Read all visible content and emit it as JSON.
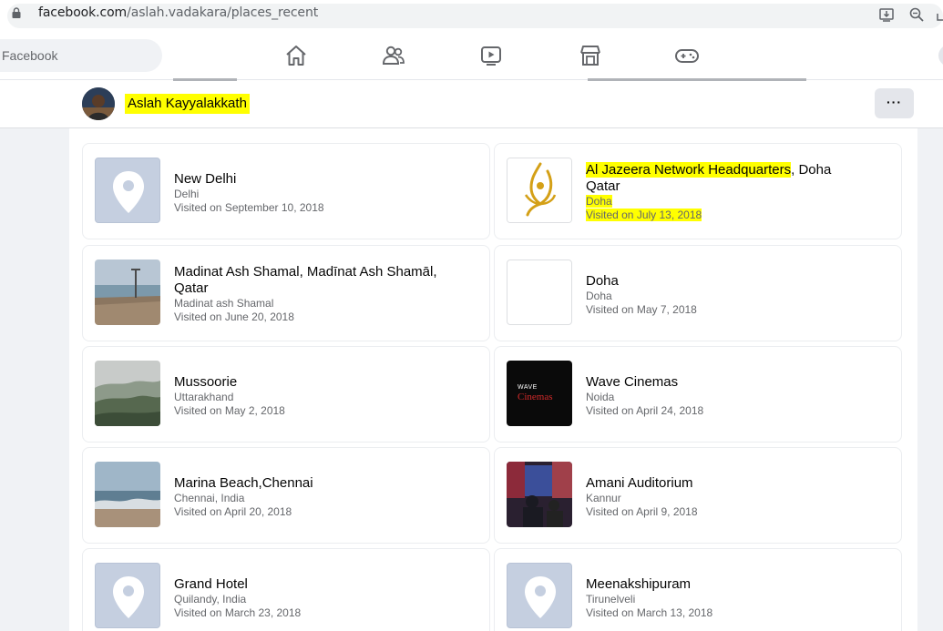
{
  "browser": {
    "url_host": "facebook.com",
    "url_path": "/aslah.vadakara/places_recent"
  },
  "fb_nav": {
    "search_placeholder": "Facebook"
  },
  "profile": {
    "name": "Aslah Kayyalakkath",
    "more_label": "···"
  },
  "places": [
    {
      "title": "New Delhi",
      "location": "Delhi",
      "visited": "Visited on September 10, 2018",
      "thumb": "pin"
    },
    {
      "title_hl": "Al Jazeera Network Headquarters",
      "title_rest": ", Doha",
      "title_line2": "Qatar",
      "location": "Doha",
      "visited": "Visited on July 13, 2018",
      "thumb": "aljazeera-logo"
    },
    {
      "title_line1": "Madinat Ash Shamal, Madīnat Ash Shamāl,",
      "title_line2": "Qatar",
      "location": "Madinat ash Shamal",
      "visited": "Visited on June 20, 2018",
      "thumb": "seafront-photo"
    },
    {
      "title": "Doha",
      "location": "Doha",
      "visited": "Visited on May 7, 2018",
      "thumb": "blank"
    },
    {
      "title": "Mussoorie",
      "location": "Uttarakhand",
      "visited": "Visited on May 2, 2018",
      "thumb": "misty-hills-photo"
    },
    {
      "title": "Wave Cinemas",
      "location": "Noida",
      "visited": "Visited on April 24, 2018",
      "thumb": "wave-cinemas-logo",
      "logo_line1": "WAVE",
      "logo_line2": "Cinemas"
    },
    {
      "title": "Marina Beach,Chennai",
      "location": "Chennai, India",
      "visited": "Visited on April 20, 2018",
      "thumb": "beach-photo"
    },
    {
      "title": "Amani Auditorium",
      "location": "Kannur",
      "visited": "Visited on April 9, 2018",
      "thumb": "auditorium-photo"
    },
    {
      "title": "Grand Hotel",
      "location": "Quilandy, India",
      "visited": "Visited on March 23, 2018",
      "thumb": "pin"
    },
    {
      "title": "Meenakshipuram",
      "location": "Tirunelveli",
      "visited": "Visited on March 13, 2018",
      "thumb": "pin"
    }
  ],
  "colors": {
    "highlight": "#ffff00",
    "pin_bg": "#c5cfe0",
    "text_secondary": "#65676b"
  }
}
